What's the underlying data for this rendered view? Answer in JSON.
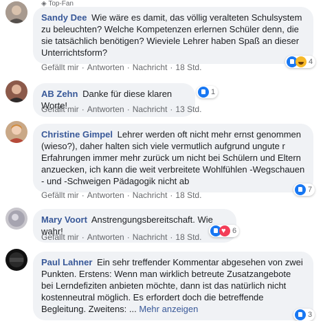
{
  "comments": [
    {
      "badge": "Top-Fan",
      "name": "Sandy Dee",
      "text": "Wie wäre es damit, das völlig veralteten Schulsystem zu beleuchten? Welche Kompetenzen erlernen Schüler denn, die sie tatsächlich benötigen? Wieviele Lehrer haben Spaß an dieser Unterrichtsform?",
      "like": "Gefällt mir",
      "reply": "Antworten",
      "message": "Nachricht",
      "time": "18 Std.",
      "reactions": [
        "like",
        "haha"
      ],
      "reaction_count": "4"
    },
    {
      "name": "AB Zehn",
      "text": "Danke für diese klaren Worte!",
      "like": "Gefällt mir",
      "reply": "Antworten",
      "message": "Nachricht",
      "time": "13 Std.",
      "reactions": [
        "like"
      ],
      "reaction_count": "1"
    },
    {
      "name": "Christine Gimpel",
      "text": "Lehrer werden oft nicht mehr ernst genommen (wieso?), daher halten sich viele vermutlich aufgrund ungute r Erfahrungen immer mehr zurück um nicht bei Schülern und Eltern anzuecken, ich kann die weit verbreitete Wohlfühlen -Wegschauen - und -Schweigen Pädagogik nicht ab",
      "like": "Gefällt mir",
      "reply": "Antworten",
      "message": "Nachricht",
      "time": "18 Std.",
      "reactions": [
        "like"
      ],
      "reaction_count": "7"
    },
    {
      "name": "Mary Voort",
      "text": "Anstrengungsbereitschaft. Wie wahr!",
      "like": "Gefällt mir",
      "reply": "Antworten",
      "message": "Nachricht",
      "time": "18 Std.",
      "reactions": [
        "like",
        "love"
      ],
      "reaction_count": "6"
    },
    {
      "name": "Paul Lahner",
      "text": "Ein sehr treffender Kommentar abgesehen von zwei Punkten. Erstens: Wenn man wirklich betreute Zusatzangebote bei Lerndefiziten anbieten möchte, dann ist das natürlich nicht kostenneutral möglich. Es erfordert doch die betreffende Begleitung. Zweitens: ...",
      "more": "Mehr anzeigen",
      "reaction_count": "3"
    }
  ],
  "colors": {
    "link": "#385898",
    "bubble": "#f0f2f5",
    "meta": "#65676b"
  }
}
